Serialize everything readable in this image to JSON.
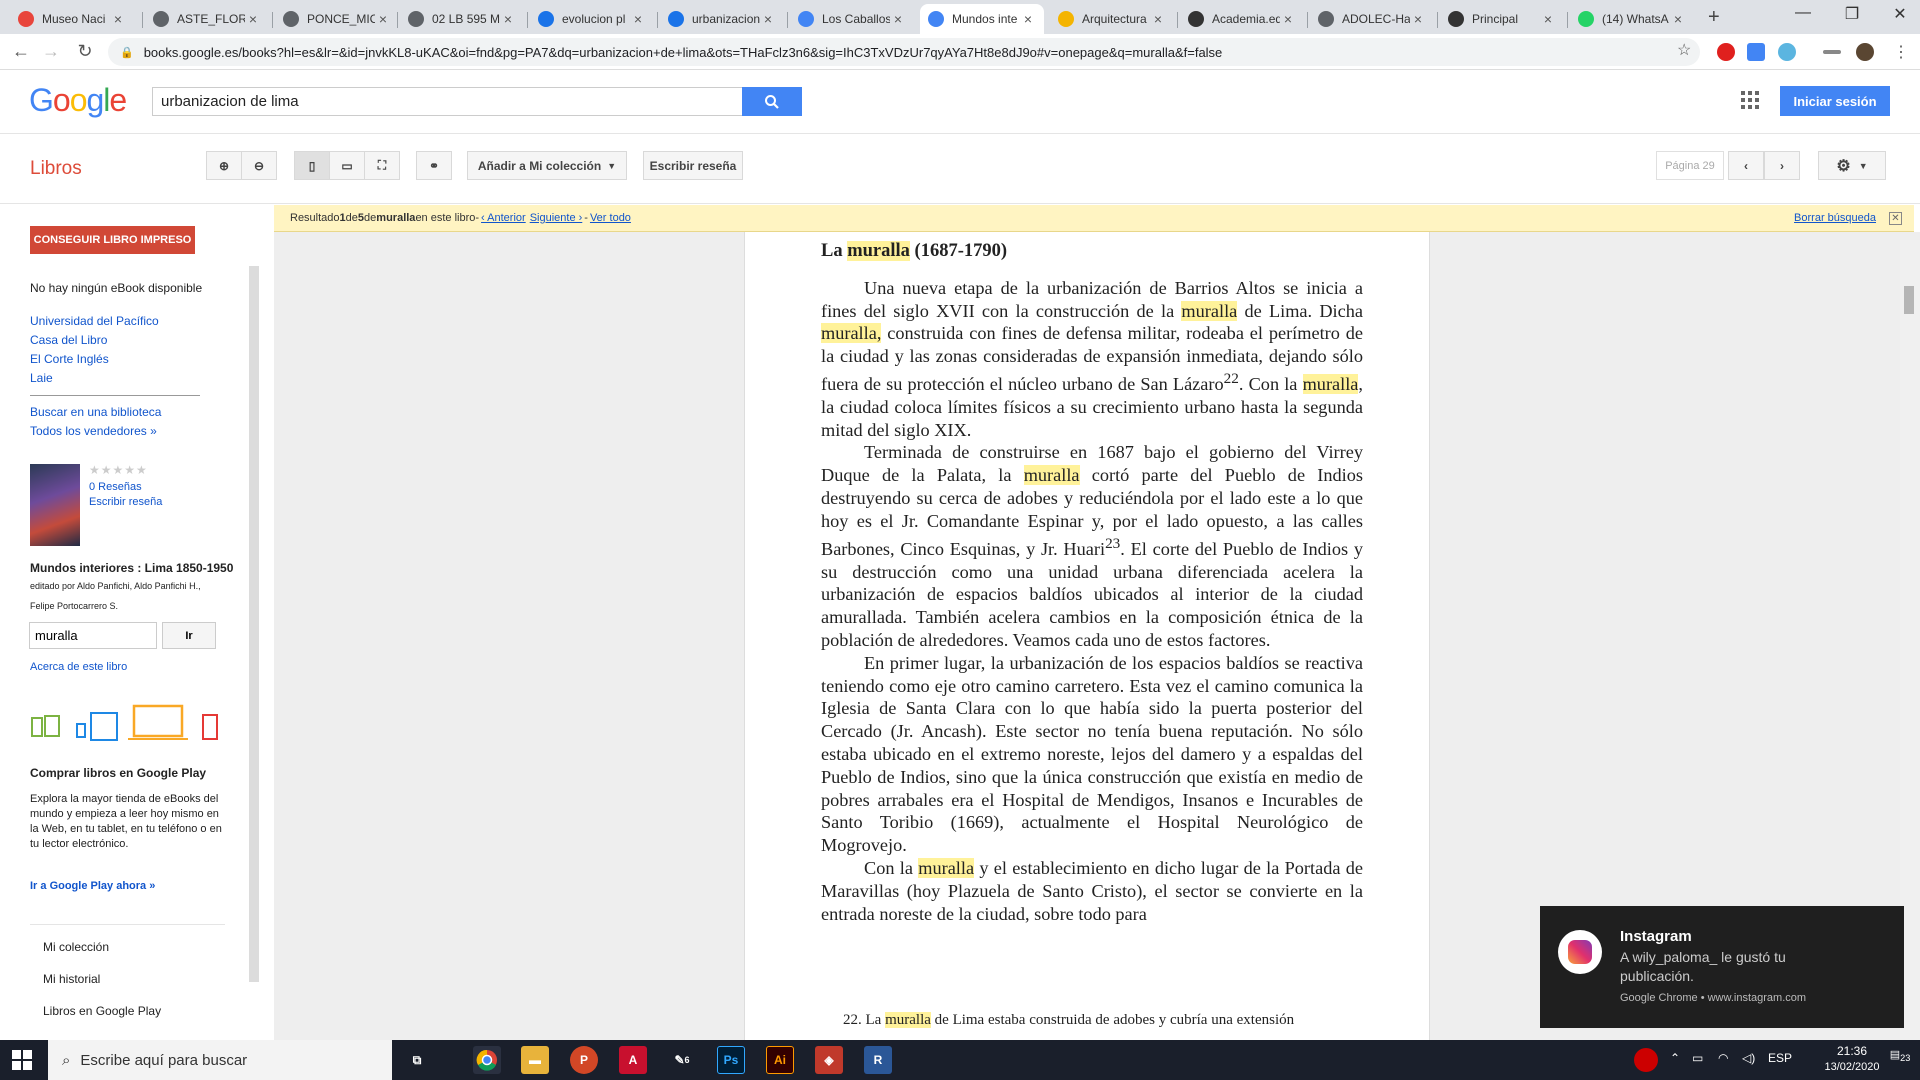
{
  "browser": {
    "tabs": [
      {
        "title": "Museo Naci",
        "color": "#e8453c"
      },
      {
        "title": "ASTE_FLORE",
        "color": "#5f6368"
      },
      {
        "title": "PONCE_MIC",
        "color": "#5f6368"
      },
      {
        "title": "02 LB 595 M",
        "color": "#5f6368"
      },
      {
        "title": "evolucion pl",
        "color": "#1a73e8"
      },
      {
        "title": "urbanizacion",
        "color": "#1a73e8"
      },
      {
        "title": "Los Caballos",
        "color": "#4285f4"
      },
      {
        "title": "Mundos inte",
        "color": "#4285f4"
      },
      {
        "title": "Arquitectura",
        "color": "#f4b400"
      },
      {
        "title": "Academia.ed",
        "color": "#333333"
      },
      {
        "title": "ADOLEC-Ha",
        "color": "#5f6368"
      },
      {
        "title": "Principal",
        "color": "#333333"
      },
      {
        "title": "(14) WhatsA",
        "color": "#25d366"
      }
    ],
    "url": "books.google.es/books?hl=es&lr=&id=jnvkKL8-uKAC&oi=fnd&pg=PA7&dq=urbanizacion+de+lima&ots=THaFclz3n6&sig=IhC3TxVDzUr7qyAYa7Ht8e8dJ9o#v=onepage&q=muralla&f=false"
  },
  "google": {
    "logo": [
      "G",
      "o",
      "o",
      "g",
      "l",
      "e"
    ],
    "logo_colors": [
      "#4285f4",
      "#ea4335",
      "#fbbc05",
      "#4285f4",
      "#34a853",
      "#ea4335"
    ],
    "search_value": "urbanizacion de lima",
    "signin_label": "Iniciar sesión"
  },
  "toolbar": {
    "section_label": "Libros",
    "add_collection_label": "Añadir a Mi colección",
    "write_review_label": "Escribir reseña",
    "page_label": "Página 29"
  },
  "resultbar": {
    "text_prefix": "Resultado ",
    "result_num": "1",
    "text_of": " de ",
    "result_total": "5",
    "text_de": " de ",
    "query": "muralla",
    "text_suffix": " en este libro",
    "dash": " - ",
    "prev_label": "‹ Anterior",
    "next_label": "Siguiente ›",
    "view_all_label": "Ver todo",
    "clear_label": "Borrar búsqueda"
  },
  "sidebar": {
    "get_book_label": "CONSEGUIR LIBRO IMPRESO",
    "no_ebook": "No hay ningún eBook disponible",
    "sellers": [
      "Universidad del Pacífico",
      "Casa del Libro",
      "El Corte Inglés",
      "Laie"
    ],
    "library_link": "Buscar en una biblioteca",
    "all_sellers_link": "Todos los vendedores »",
    "rating_stars": "★★★★★",
    "reviews_link": "0 Reseñas",
    "write_review_link": "Escribir reseña",
    "book_title": "Mundos interiores : Lima 1850-1950",
    "editors_line1": "editado por Aldo Panfichi, Aldo Panfichi H.,",
    "editors_line2": "Felipe Portocarrero S.",
    "search_value": "muralla",
    "search_go_label": "Ir",
    "about_link": "Acerca de este libro",
    "play_heading": "Comprar libros en Google Play",
    "play_text": "Explora la mayor tienda de eBooks del mundo y empieza a leer hoy mismo en la Web, en tu tablet, en tu teléfono o en tu lector electrónico.",
    "play_link": "Ir a Google Play ahora »",
    "menu": [
      "Mi colección",
      "Mi historial",
      "Libros en Google Play"
    ]
  },
  "page": {
    "heading_pre": "La ",
    "heading_hl": "muralla",
    "heading_post": " (1687-1790)",
    "p1_a": "Una nueva etapa de la urbanización de Barrios Altos se inicia a fines del siglo XVII con la construcción de la ",
    "p1_hl1": "muralla",
    "p1_b": " de Lima. Dicha ",
    "p1_hl2": "muralla,",
    "p1_c": " construida con fines de defensa militar, rodeaba el perímetro de la ciudad y las zonas consideradas de expansión inmediata, dejando sólo fuera de su protección el núcleo urbano de San Lázaro",
    "p1_sup": "22",
    "p1_d": ". Con la ",
    "p1_hl3": "muralla",
    "p1_e": ", la ciudad coloca límites físicos a su crecimiento urbano hasta la segunda mitad del siglo XIX.",
    "p2_a": "Terminada de construirse en 1687 bajo el gobierno del Virrey Duque de la Palata, la ",
    "p2_hl": "muralla",
    "p2_b": " cortó parte del Pueblo de Indios destruyendo su cerca de adobes y reduciéndola por el lado este a lo que hoy es el Jr. Comandante Espinar y, por el lado opuesto, a las calles Barbones, Cinco Esquinas, y Jr. Huari",
    "p2_sup": "23",
    "p2_c": ". El corte del Pueblo de Indios y su destrucción como una unidad urbana diferenciada acelera la urbanización de espacios baldíos ubicados al interior de la ciudad amurallada. También acelera cambios en la composición étnica de la población de alrededores. Veamos cada uno de estos factores.",
    "p3": "En primer lugar, la urbanización de los espacios baldíos se reactiva teniendo como eje otro camino carretero. Esta vez el camino comunica la Iglesia de Santa Clara con lo que había sido la puerta posterior del Cercado (Jr. Ancash). Este sector no tenía buena reputación. No sólo estaba ubicado en el extremo noreste, lejos del damero y a espaldas del Pueblo de Indios, sino que la única construcción que existía en medio de pobres arrabales era el Hospital de Mendigos, Insanos e Incurables de Santo Toribio (1669), actualmente el Hospital Neurológico de Mogrovejo.",
    "p4_a": "Con la ",
    "p4_hl": "muralla",
    "p4_b": " y el establecimiento en dicho lugar de la Portada de Maravillas (hoy Plazuela de Santo Cristo), el sector se convierte en la entrada noreste de la ciudad, sobre todo para",
    "fn_a": "22. La ",
    "fn_hl": "muralla",
    "fn_b": " de Lima estaba construida de adobes y cubría una extensión"
  },
  "notification": {
    "app": "Instagram",
    "message": "A wily_paloma_ le gustó tu publicación.",
    "source": "Google Chrome • www.instagram.com"
  },
  "taskbar": {
    "search_placeholder": "Escribe aquí para buscar",
    "lang": "ESP",
    "time": "21:36",
    "date": "13/02/2020",
    "notif_count": "23",
    "badge": "6"
  }
}
